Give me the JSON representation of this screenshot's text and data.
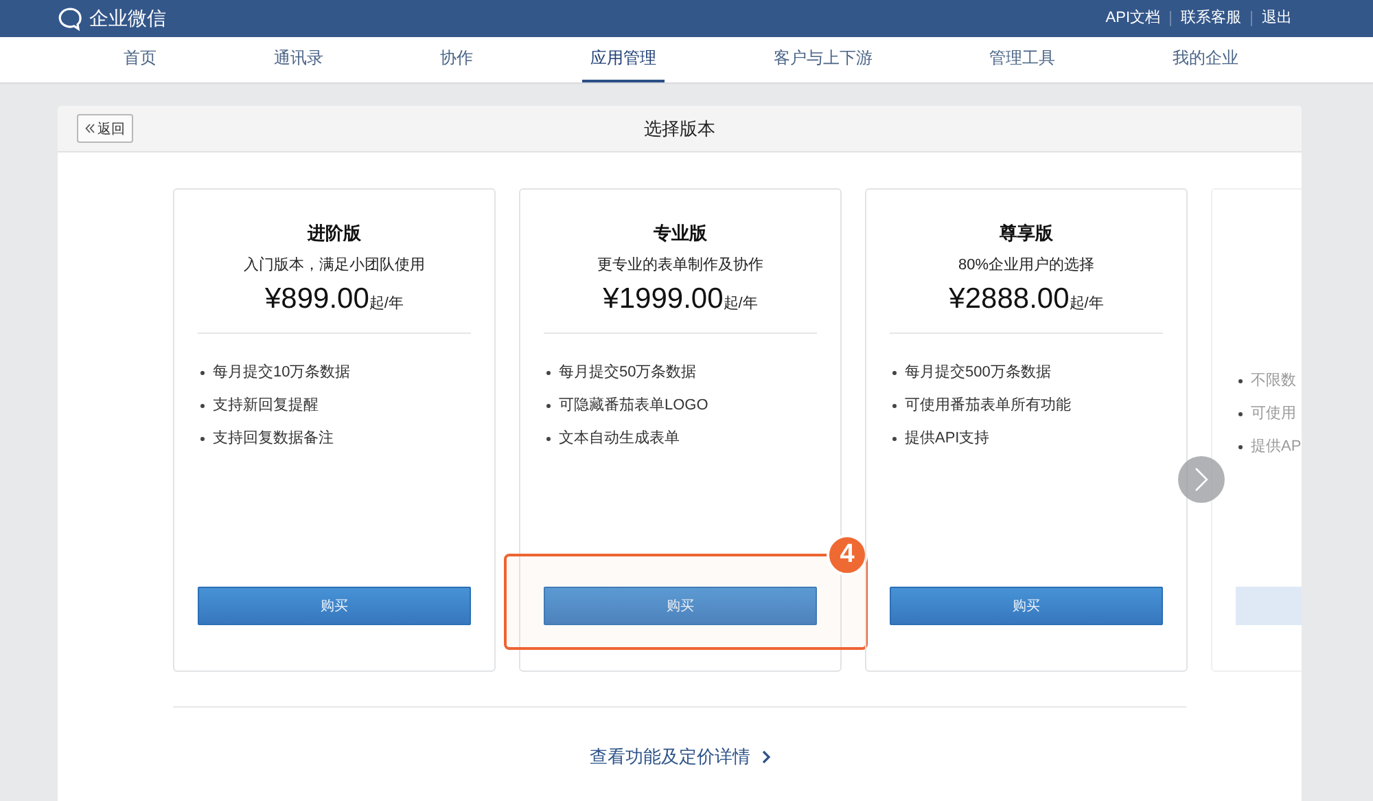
{
  "topbar": {
    "logo": "企业微信",
    "links": [
      "API文档",
      "联系客服",
      "退出"
    ]
  },
  "nav": [
    {
      "label": "首页",
      "selected": false
    },
    {
      "label": "通讯录",
      "selected": false
    },
    {
      "label": "协作",
      "selected": false
    },
    {
      "label": "应用管理",
      "selected": true
    },
    {
      "label": "客户与上下游",
      "selected": false
    },
    {
      "label": "管理工具",
      "selected": false
    },
    {
      "label": "我的企业",
      "selected": false
    }
  ],
  "panel": {
    "back_button": "返回",
    "title": "选择版本"
  },
  "plans": [
    {
      "name": "进阶版",
      "subtitle": "入门版本，满足小团队使用",
      "price": "¥899.00",
      "unit": "起/年",
      "features": [
        "每月提交10万条数据",
        "支持新回复提醒",
        "支持回复数据备注"
      ],
      "button": "购买",
      "faded": false
    },
    {
      "name": "专业版",
      "subtitle": "更专业的表单制作及协作",
      "price": "¥1999.00",
      "unit": "起/年",
      "features": [
        "每月提交50万条数据",
        "可隐藏番茄表单LOGO",
        "文本自动生成表单"
      ],
      "button": "购买",
      "faded": false,
      "callout": "4"
    },
    {
      "name": "尊享版",
      "subtitle": "80%企业用户的选择",
      "price": "¥2888.00",
      "unit": "起/年",
      "features": [
        "每月提交500万条数据",
        "可使用番茄表单所有功能",
        "提供API支持"
      ],
      "button": "购买",
      "faded": false
    },
    {
      "features": [
        "不限数",
        "可使用",
        "提供AP"
      ],
      "faded": true
    }
  ],
  "details_link": "查看功能及定价详情"
}
